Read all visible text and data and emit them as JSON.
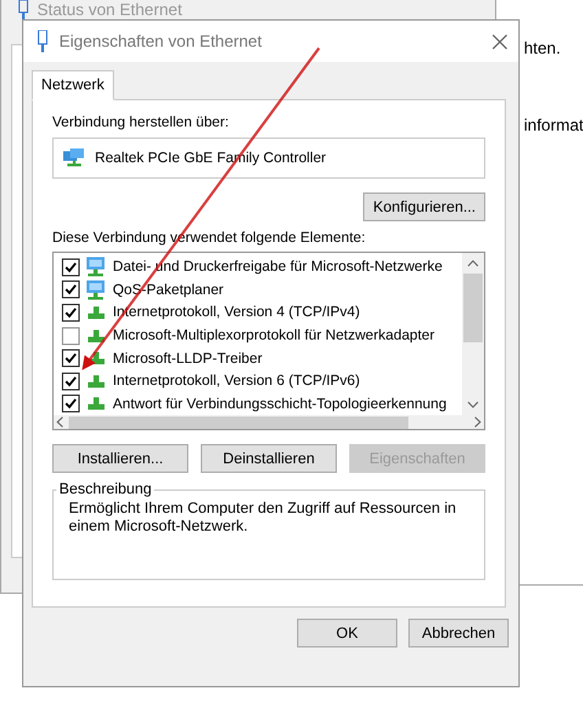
{
  "rear_window": {
    "texts": [
      "hten.",
      "informat"
    ]
  },
  "back_window": {
    "title": "Status von Ethernet"
  },
  "dialog": {
    "title": "Eigenschaften von Ethernet",
    "tabs": [
      {
        "label": "Netzwerk",
        "selected": true
      }
    ],
    "connect_label": "Verbindung herstellen über:",
    "adapter": "Realtek PCIe GbE Family Controller",
    "configure_button": "Konfigurieren...",
    "items_label": "Diese Verbindung verwendet folgende Elemente:",
    "items": [
      {
        "label": "Datei- und Druckerfreigabe für Microsoft-Netzwerke",
        "checked": true,
        "kind": "service"
      },
      {
        "label": "QoS-Paketplaner",
        "checked": true,
        "kind": "service"
      },
      {
        "label": "Internetprotokoll, Version 4 (TCP/IPv4)",
        "checked": true,
        "kind": "protocol"
      },
      {
        "label": "Microsoft-Multiplexorprotokoll für Netzwerkadapter",
        "checked": false,
        "kind": "protocol"
      },
      {
        "label": "Microsoft-LLDP-Treiber",
        "checked": true,
        "kind": "protocol"
      },
      {
        "label": "Internetprotokoll, Version 6 (TCP/IPv6)",
        "checked": true,
        "kind": "protocol"
      },
      {
        "label": "Antwort für Verbindungsschicht-Topologieerkennung",
        "checked": true,
        "kind": "protocol"
      }
    ],
    "item_buttons": [
      {
        "label": "Installieren...",
        "disabled": false
      },
      {
        "label": "Deinstallieren",
        "disabled": false
      },
      {
        "label": "Eigenschaften",
        "disabled": true
      }
    ],
    "description": {
      "title": "Beschreibung",
      "text": "Ermöglicht Ihrem Computer den Zugriff auf Ressourcen in einem Microsoft-Netzwerk."
    },
    "footer_buttons": [
      {
        "label": "OK",
        "disabled": false
      },
      {
        "label": "Abbrechen",
        "disabled": false
      }
    ]
  }
}
